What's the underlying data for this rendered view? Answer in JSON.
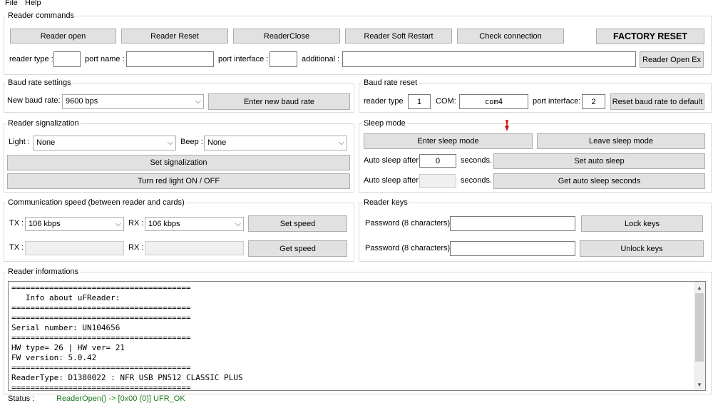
{
  "menu": {
    "file": "File",
    "help": "Help"
  },
  "reader_commands": {
    "title": "Reader commands",
    "buttons": [
      "Reader open",
      "Reader Reset",
      "ReaderClose",
      "Reader Soft Restart",
      "Check connection"
    ],
    "factory_reset": "FACTORY RESET",
    "reader_type_label": "reader type :",
    "reader_type_value": "",
    "port_name_label": "port name :",
    "port_name_value": "",
    "port_interface_label": "port interface :",
    "port_interface_value": "",
    "additional_label": "additional :",
    "additional_value": "",
    "open_ex": "Reader Open Ex"
  },
  "baud_settings": {
    "title": "Baud rate settings",
    "label": "New baud rate:",
    "selected": "9600 bps",
    "enter_button": "Enter new baud rate"
  },
  "baud_reset": {
    "title": "Baud rate reset",
    "reader_type_label": "reader type",
    "reader_type_value": "1",
    "com_label": "COM:",
    "com_value": "com4",
    "port_interface_label": "port interface:",
    "port_interface_value": "2",
    "reset_button": "Reset baud rate to default"
  },
  "signalization": {
    "title": "Reader signalization",
    "light_label": "Light :",
    "light_selected": "None",
    "beep_label": "Beep :",
    "beep_selected": "None",
    "set_button": "Set signalization",
    "red_light_button": "Turn red light ON / OFF"
  },
  "sleep_mode": {
    "title": "Sleep mode",
    "enter_button": "Enter sleep mode",
    "leave_button": "Leave sleep mode",
    "auto_label": "Auto sleep after",
    "auto_value": "0",
    "seconds_label": "seconds.",
    "set_auto_button": "Set auto sleep",
    "auto_label2": "Auto sleep after",
    "auto_value2": "",
    "seconds_label2": "seconds.",
    "get_auto_button": "Get auto sleep seconds"
  },
  "comm_speed": {
    "title": "Communication speed (between reader and cards)",
    "tx_label": "TX :",
    "tx_selected": "106 kbps",
    "rx_label": "RX :",
    "rx_selected": "106 kbps",
    "set_button": "Set speed",
    "tx_label2": "TX :",
    "tx_value": "",
    "rx_label2": "RX :",
    "rx_value": "",
    "get_button": "Get speed"
  },
  "reader_keys": {
    "title": "Reader keys",
    "password_label": "Password (8 characters) :",
    "password_value": "",
    "lock_button": "Lock keys",
    "password_label2": "Password (8 characters) :",
    "password_value2": "",
    "unlock_button": "Unlock keys"
  },
  "reader_info": {
    "title": "Reader informations",
    "log": "======================================\n   Info about uFReader:\n======================================\n======================================\nSerial number: UN104656\n======================================\nHW type= 26 | HW ver= 21\nFW version: 5.0.42\n======================================\nReaderType: D1380022 : NFR USB PN512 CLASSIC PLUS\n======================================"
  },
  "status": {
    "label": "Status :",
    "value": "ReaderOpen() -> [0x00 (0)] UFR_OK"
  }
}
